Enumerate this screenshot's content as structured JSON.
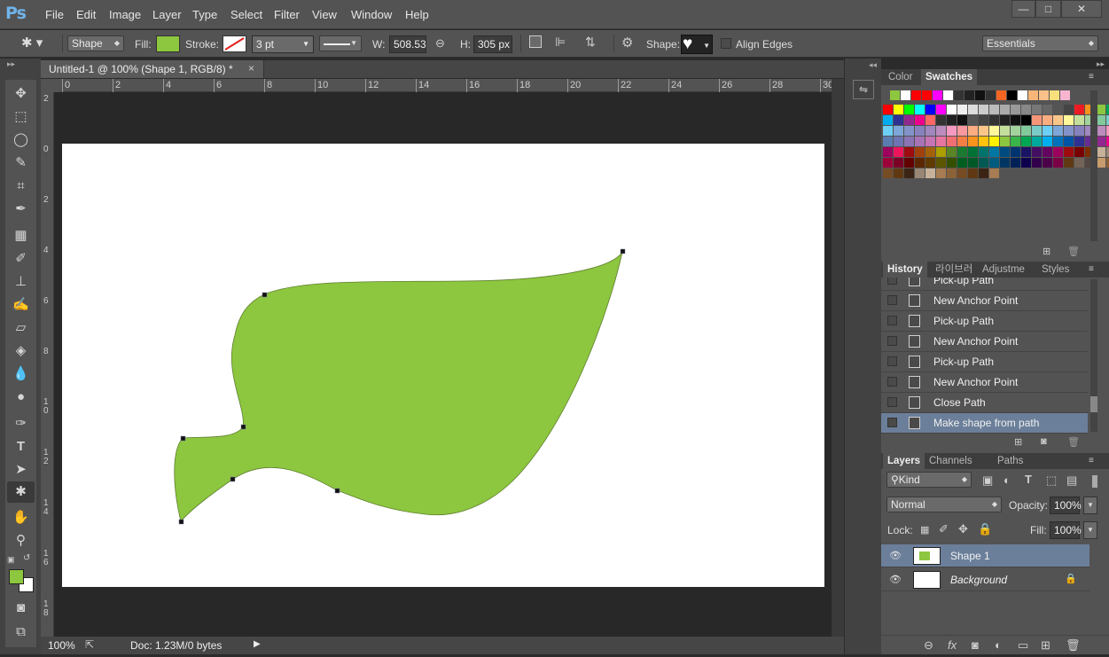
{
  "app": {
    "logo": "Ps"
  },
  "menu": [
    "File",
    "Edit",
    "Image",
    "Layer",
    "Type",
    "Select",
    "Filter",
    "View",
    "Window",
    "Help"
  ],
  "window_controls": [
    "—",
    "□",
    "✕"
  ],
  "options": {
    "mode": "Shape",
    "fill_label": "Fill:",
    "stroke_label": "Stroke:",
    "stroke_width": "3 pt",
    "w_label": "W:",
    "w_value": "508.53",
    "h_label": "H:",
    "h_value": "305 px",
    "shape_label": "Shape:",
    "align_edges": "Align Edges",
    "workspace": "Essentials",
    "fill_color": "#8dc63f"
  },
  "document": {
    "tab_title": "Untitled-1 @ 100% (Shape 1, RGB/8) *",
    "close": "×"
  },
  "ruler_top": [
    "0",
    "2",
    "4",
    "6",
    "8",
    "10",
    "12",
    "14",
    "16",
    "18",
    "20",
    "22",
    "24",
    "26",
    "28",
    "30"
  ],
  "ruler_left": [
    "2",
    "0",
    "2",
    "4",
    "6",
    "8",
    "1\n0",
    "1\n2",
    "1\n4",
    "1\n6",
    "1\n8"
  ],
  "status": {
    "zoom": "100%",
    "doc": "Doc: 1.23M/0 bytes"
  },
  "shape_color": "#8dc63f",
  "color_panel": {
    "tabs": [
      "Color",
      "Swatches"
    ]
  },
  "history_panel": {
    "tabs": [
      "History",
      "라이브러",
      "Adjustme",
      "Styles"
    ],
    "items": [
      "Pick-up Path",
      "New Anchor Point",
      "Pick-up Path",
      "New Anchor Point",
      "Pick-up Path",
      "New Anchor Point",
      "Close Path",
      "Make shape from path"
    ]
  },
  "layers_panel": {
    "tabs": [
      "Layers",
      "Channels",
      "Paths"
    ],
    "filter": "Kind",
    "blend_mode": "Normal",
    "opacity_label": "Opacity:",
    "opacity": "100%",
    "lock_label": "Lock:",
    "fill_label": "Fill:",
    "fill": "100%",
    "layers": [
      {
        "name": "Shape 1",
        "selected": true
      },
      {
        "name": "Background",
        "selected": false
      }
    ]
  }
}
